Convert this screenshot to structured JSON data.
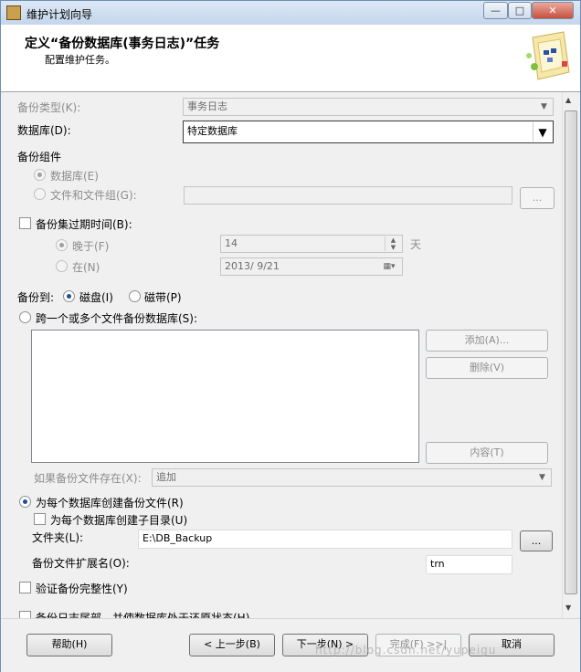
{
  "window": {
    "title": "维护计划向导",
    "minimize": "—",
    "maximize": "□",
    "close": "✕"
  },
  "header": {
    "title": "定义“备份数据库(事务日志)”任务",
    "subtitle": "配置维护任务。",
    "icon": "wizard-banner-icon"
  },
  "form": {
    "backup_type": {
      "label": "备份类型(K):",
      "value": "事务日志"
    },
    "database": {
      "label": "数据库(D):",
      "value": "特定数据库"
    },
    "backup_component": {
      "label": "备份组件",
      "database_option": "数据库(E)",
      "files_option": "文件和文件组(G):",
      "browse": "..."
    },
    "expire": {
      "label": "备份集过期时间(B):",
      "after_label": "晚于(F)",
      "after_value": "14",
      "after_unit": "天",
      "on_label": "在(N)",
      "on_value": "2013/ 9/21"
    },
    "backup_to": {
      "label": "备份到:",
      "disk": "磁盘(I)",
      "tape": "磁带(P)"
    },
    "span": {
      "label": "跨一个或多个文件备份数据库(S):",
      "add": "添加(A)...",
      "remove": "删除(V)",
      "contents": "内容(T)",
      "if_exists_label": "如果备份文件存在(X):",
      "if_exists_value": "追加"
    },
    "per_db": {
      "label": "为每个数据库创建备份文件(R)",
      "subdir_label": "为每个数据库创建子目录(U)",
      "folder_label": "文件夹(L):",
      "folder_value": "E:\\DB_Backup",
      "browse": "...",
      "ext_label": "备份文件扩展名(O):",
      "ext_value": "trn"
    },
    "verify_label": "验证备份完整性(Y)",
    "tail_log_label": "备份日志尾部，并使数据库处于还原状态(H)"
  },
  "footer": {
    "help": "帮助(H)",
    "back": "< 上一步(B)",
    "next": "下一步(N) >",
    "finish": "完成(F) >>|",
    "cancel": "取消"
  },
  "watermark": "http://blog.csdn.net/yupeigu"
}
